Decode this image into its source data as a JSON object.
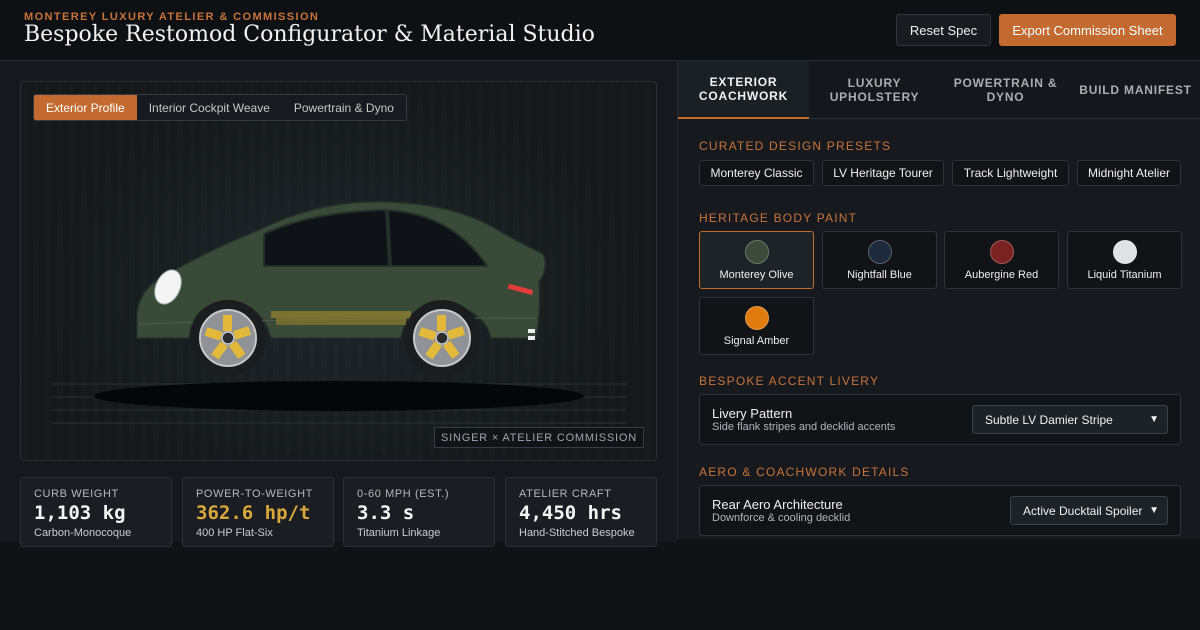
{
  "header": {
    "eyebrow": "MONTEREY LUXURY ATELIER & COMMISSION",
    "title": "Bespoke Restomod Configurator & Material Studio",
    "reset_label": "Reset Spec",
    "export_label": "Export Commission Sheet"
  },
  "viewer": {
    "tabs": [
      "Exterior Profile",
      "Interior Cockpit Weave",
      "Powertrain & Dyno"
    ],
    "active_tab": "Exterior Profile",
    "commission_tag": "SINGER × ATELIER COMMISSION",
    "car_color": "#3a4a38"
  },
  "stats": [
    {
      "label": "CURB WEIGHT",
      "value": "1,103 kg",
      "sub": "Carbon-Monocoque"
    },
    {
      "label": "POWER-TO-WEIGHT",
      "value": "362.6 hp/t",
      "sub": "400 HP Flat-Six"
    },
    {
      "label": "0-60 MPH (EST.)",
      "value": "3.3 s",
      "sub": "Titanium Linkage"
    },
    {
      "label": "ATELIER CRAFT",
      "value": "4,450 hrs",
      "sub": "Hand-Stitched Bespoke"
    }
  ],
  "config": {
    "tabs": [
      "EXTERIOR COACHWORK",
      "LUXURY UPHOLSTERY",
      "POWERTRAIN & DYNO",
      "BUILD MANIFEST"
    ],
    "active_tab": "EXTERIOR COACHWORK",
    "presets_title": "CURATED DESIGN PRESETS",
    "presets": [
      "Monterey Classic",
      "LV Heritage Tourer",
      "Track Lightweight",
      "Midnight Atelier"
    ],
    "paint_title": "HERITAGE BODY PAINT",
    "paints": [
      {
        "name": "Monterey Olive",
        "color": "#3b4a3a",
        "selected": true
      },
      {
        "name": "Nightfall Blue",
        "color": "#1e2a3c",
        "selected": false
      },
      {
        "name": "Aubergine Red",
        "color": "#7a2222",
        "selected": false
      },
      {
        "name": "Liquid Titanium",
        "color": "#dfe1e3",
        "selected": false
      },
      {
        "name": "Signal Amber",
        "color": "#e07b10",
        "selected": false
      }
    ],
    "livery_title": "BESPOKE ACCENT LIVERY",
    "livery": {
      "title": "Livery Pattern",
      "sub": "Side flank stripes and decklid accents",
      "value": "Subtle LV Damier Stripe"
    },
    "aero_title": "AERO & COACHWORK DETAILS",
    "aero": {
      "title": "Rear Aero Architecture",
      "sub": "Downforce & cooling decklid",
      "value": "Active Ducktail Spoiler"
    }
  }
}
